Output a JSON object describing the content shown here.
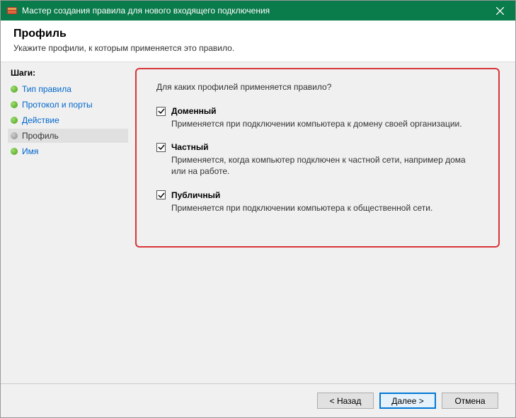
{
  "titlebar": {
    "title": "Мастер создания правила для нового входящего подключения"
  },
  "header": {
    "title": "Профиль",
    "description": "Укажите профили, к которым применяется это правило."
  },
  "sidebar": {
    "label": "Шаги:",
    "steps": [
      {
        "label": "Тип правила"
      },
      {
        "label": "Протокол и порты"
      },
      {
        "label": "Действие"
      },
      {
        "label": "Профиль"
      },
      {
        "label": "Имя"
      }
    ]
  },
  "content": {
    "question": "Для каких профилей применяется правило?",
    "options": [
      {
        "label": "Доменный",
        "description": "Применяется при подключении компьютера к домену своей организации."
      },
      {
        "label": "Частный",
        "description": "Применяется, когда компьютер подключен к частной сети, например дома или на работе."
      },
      {
        "label": "Публичный",
        "description": "Применяется при подключении компьютера к общественной сети."
      }
    ]
  },
  "footer": {
    "back": "< Назад",
    "next": "Далее >",
    "cancel": "Отмена"
  }
}
